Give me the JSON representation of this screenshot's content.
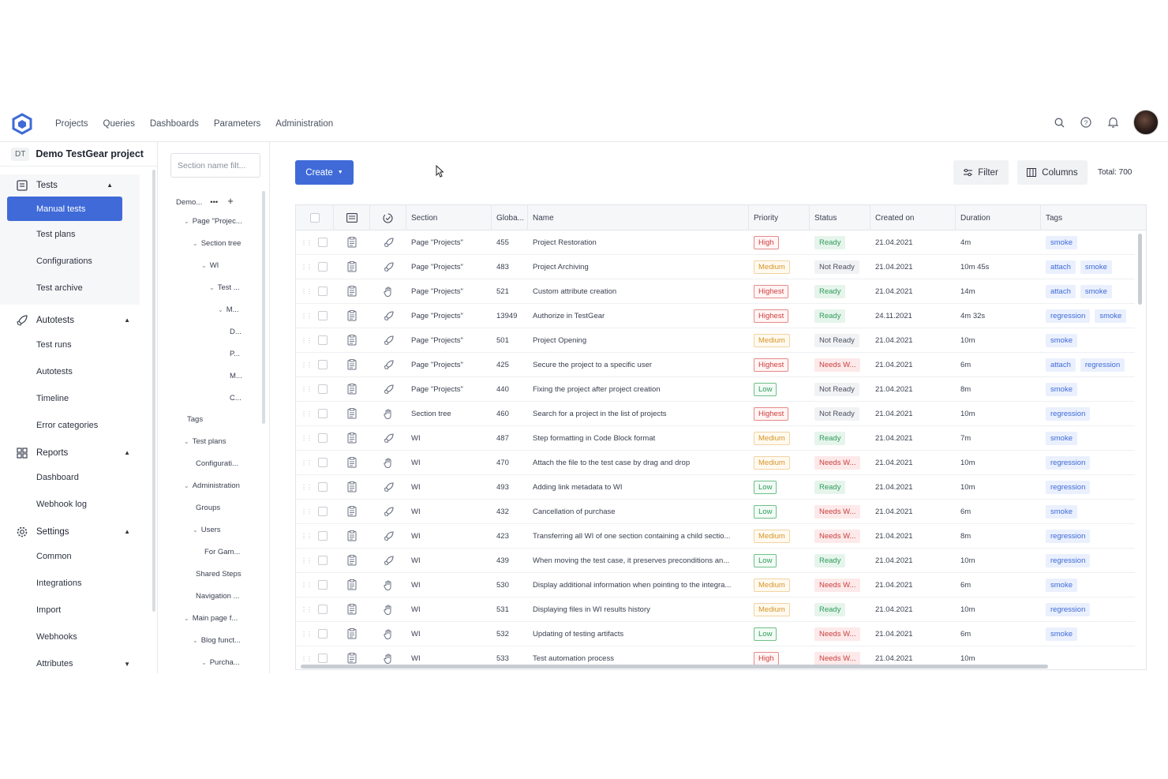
{
  "nav": {
    "links": [
      "Projects",
      "Queries",
      "Dashboards",
      "Parameters",
      "Administration"
    ]
  },
  "colors": {
    "accent": "#3f6ad8"
  },
  "project": {
    "badge": "DT",
    "name": "Demo TestGear project"
  },
  "sidebar": {
    "tests": {
      "label": "Tests",
      "items": [
        "Manual tests",
        "Test plans",
        "Configurations",
        "Test archive"
      ]
    },
    "autotests": {
      "label": "Autotests",
      "items": [
        "Test runs",
        "Autotests",
        "Timeline",
        "Error categories"
      ]
    },
    "reports": {
      "label": "Reports",
      "items": [
        "Dashboard",
        "Webhook log"
      ]
    },
    "settings": {
      "label": "Settings",
      "items": [
        "Common",
        "Integrations",
        "Import",
        "Webhooks"
      ]
    },
    "attributes": {
      "label": "Attributes"
    }
  },
  "tree": {
    "search_placeholder": "Section name filt...",
    "root": "Demo...",
    "nodes": [
      "Page \"Projec...",
      "Section tree",
      "WI",
      "Test ...",
      "M...",
      "D...",
      "P...",
      "M...",
      "C...",
      "Tags",
      "Test plans",
      "Configurati...",
      "Administration",
      "Groups",
      "Users",
      "For Gam...",
      "Shared Steps",
      "Navigation ...",
      "Main page f...",
      "Blog funct...",
      "Purcha..."
    ]
  },
  "toolbar": {
    "create": "Create",
    "filter": "Filter",
    "columns": "Columns",
    "total": "Total: 700"
  },
  "table": {
    "columns": {
      "section": "Section",
      "global": "Globa...",
      "name": "Name",
      "priority": "Priority",
      "status": "Status",
      "created": "Created on",
      "duration": "Duration",
      "tags": "Tags"
    },
    "rows": [
      {
        "type": "auto",
        "section": "Page \"Projects\"",
        "id": "455",
        "name": "Project Restoration",
        "priority": "High",
        "status": "Ready",
        "created": "21.04.2021",
        "duration": "4m",
        "tags": [
          "smoke"
        ]
      },
      {
        "type": "auto",
        "section": "Page \"Projects\"",
        "id": "483",
        "name": "Project Archiving",
        "priority": "Medium",
        "status": "Not Ready",
        "created": "21.04.2021",
        "duration": "10m 45s",
        "tags": [
          "attach",
          "smoke"
        ]
      },
      {
        "type": "manual",
        "section": "Page \"Projects\"",
        "id": "521",
        "name": "Custom attribute creation",
        "priority": "Highest",
        "status": "Ready",
        "created": "21.04.2021",
        "duration": "14m",
        "tags": [
          "attach",
          "smoke"
        ]
      },
      {
        "type": "auto",
        "section": "Page \"Projects\"",
        "id": "13949",
        "name": "Authorize in TestGear",
        "priority": "Highest",
        "status": "Ready",
        "created": "24.11.2021",
        "duration": "4m 32s",
        "tags": [
          "regression",
          "smoke"
        ]
      },
      {
        "type": "auto",
        "section": "Page \"Projects\"",
        "id": "501",
        "name": "Project Opening",
        "priority": "Medium",
        "status": "Not Ready",
        "created": "21.04.2021",
        "duration": "10m",
        "tags": [
          "smoke"
        ]
      },
      {
        "type": "auto",
        "section": "Page \"Projects\"",
        "id": "425",
        "name": "Secure the project to a specific user",
        "priority": "Highest",
        "status": "Needs W...",
        "created": "21.04.2021",
        "duration": "6m",
        "tags": [
          "attach",
          "regression"
        ]
      },
      {
        "type": "auto",
        "section": "Page \"Projects\"",
        "id": "440",
        "name": "Fixing the project after project creation",
        "priority": "Low",
        "status": "Not Ready",
        "created": "21.04.2021",
        "duration": "8m",
        "tags": [
          "smoke"
        ]
      },
      {
        "type": "manual",
        "section": "Section tree",
        "id": "460",
        "name": "Search for a project in the list of projects",
        "priority": "Highest",
        "status": "Not Ready",
        "created": "21.04.2021",
        "duration": "10m",
        "tags": [
          "regression"
        ]
      },
      {
        "type": "auto",
        "section": "WI",
        "id": "487",
        "name": "Step formatting in Code Block format",
        "priority": "Medium",
        "status": "Ready",
        "created": "21.04.2021",
        "duration": "7m",
        "tags": [
          "smoke"
        ]
      },
      {
        "type": "manual",
        "section": "WI",
        "id": "470",
        "name": "Attach the file to the test case by drag and drop",
        "priority": "Medium",
        "status": "Needs W...",
        "created": "21.04.2021",
        "duration": "10m",
        "tags": [
          "regression"
        ]
      },
      {
        "type": "auto",
        "section": "WI",
        "id": "493",
        "name": "Adding link metadata to WI",
        "priority": "Low",
        "status": "Ready",
        "created": "21.04.2021",
        "duration": "10m",
        "tags": [
          "regression"
        ]
      },
      {
        "type": "auto",
        "section": "WI",
        "id": "432",
        "name": "Cancellation of purchase",
        "priority": "Low",
        "status": "Needs W...",
        "created": "21.04.2021",
        "duration": "6m",
        "tags": [
          "smoke"
        ]
      },
      {
        "type": "auto",
        "section": "WI",
        "id": "423",
        "name": "Transferring all WI of one section containing a child sectio...",
        "priority": "Medium",
        "status": "Needs W...",
        "created": "21.04.2021",
        "duration": "8m",
        "tags": [
          "regression"
        ]
      },
      {
        "type": "auto",
        "section": "WI",
        "id": "439",
        "name": "When moving the test case, it preserves preconditions an...",
        "priority": "Low",
        "status": "Ready",
        "created": "21.04.2021",
        "duration": "10m",
        "tags": [
          "regression"
        ]
      },
      {
        "type": "manual",
        "section": "WI",
        "id": "530",
        "name": "Display additional information when pointing to the integra...",
        "priority": "Medium",
        "status": "Needs W...",
        "created": "21.04.2021",
        "duration": "6m",
        "tags": [
          "smoke"
        ]
      },
      {
        "type": "manual",
        "section": "WI",
        "id": "531",
        "name": "Displaying files in WI results history",
        "priority": "Medium",
        "status": "Ready",
        "created": "21.04.2021",
        "duration": "10m",
        "tags": [
          "regression"
        ]
      },
      {
        "type": "manual",
        "section": "WI",
        "id": "532",
        "name": "Updating of testing artifacts",
        "priority": "Low",
        "status": "Needs W...",
        "created": "21.04.2021",
        "duration": "6m",
        "tags": [
          "smoke"
        ]
      },
      {
        "type": "manual",
        "section": "WI",
        "id": "533",
        "name": "Test automation process",
        "priority": "High",
        "status": "Needs W...",
        "created": "21.04.2021",
        "duration": "10m",
        "tags": []
      }
    ]
  }
}
